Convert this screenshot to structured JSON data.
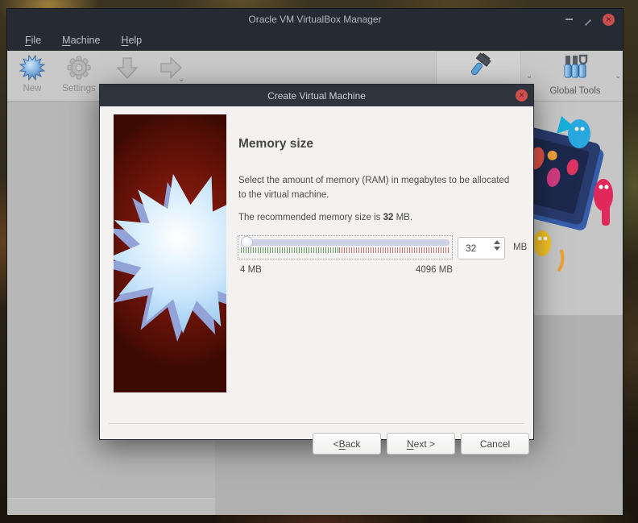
{
  "window": {
    "title": "Oracle VM VirtualBox Manager",
    "menu": {
      "items": [
        {
          "label": "File",
          "key": "F"
        },
        {
          "label": "Machine",
          "key": "M"
        },
        {
          "label": "Help",
          "key": "H"
        }
      ]
    },
    "toolbar": {
      "new_label": "New",
      "settings_label": "Settings",
      "global_tools_label": "Global Tools"
    }
  },
  "dialog": {
    "title": "Create Virtual Machine",
    "heading": "Memory size",
    "description": "Select the amount of memory (RAM) in megabytes to be allocated to the virtual machine.",
    "recommended": {
      "prefix": "The recommended memory size is ",
      "value": "32",
      "suffix": " MB."
    },
    "memory": {
      "value": "32",
      "unit": "MB",
      "min_label": "4 MB",
      "max_label": "4096 MB"
    },
    "buttons": {
      "back": {
        "label": "< Back",
        "key": "B"
      },
      "next": {
        "label": "Next >",
        "key": "N"
      },
      "cancel": {
        "label": "Cancel",
        "key": ""
      }
    }
  },
  "colors": {
    "titlebar_bg": "#262a33",
    "dialog_titlebar_bg": "#2e333d",
    "close_button_red": "#c84f4d",
    "panel_red": "#6e1409",
    "star_blue": "#a9d7f8",
    "tick_green": "#3c823c",
    "tick_red": "#c35a5a"
  }
}
